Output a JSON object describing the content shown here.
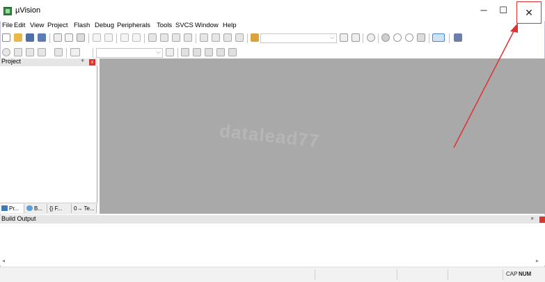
{
  "window": {
    "title": "µVision",
    "minimize": "─",
    "maximize": "☐",
    "close": "✕"
  },
  "menu": [
    "File",
    "Edit",
    "View",
    "Project",
    "Flash",
    "Debug",
    "Peripherals",
    "Tools",
    "SVCS",
    "Window",
    "Help"
  ],
  "project_panel": {
    "title": "Project",
    "pin": "ᵠ",
    "close": "x",
    "tabs": [
      {
        "label": "Pr...",
        "icon": "project-tab-icon"
      },
      {
        "label": "B...",
        "icon": "books-tab-icon"
      },
      {
        "label": "F...",
        "icon": "functions-tab-icon",
        "prefix": "{}"
      },
      {
        "label": "Te...",
        "icon": "templates-tab-icon",
        "prefix": "0→"
      }
    ]
  },
  "editor": {
    "watermark": "datalead77"
  },
  "build_output": {
    "title": "Build Output",
    "pin": "ᵠ"
  },
  "statusbar": {
    "cap": "CAP",
    "num": "NUM"
  },
  "colors": {
    "editor_bg": "#a9a9a9",
    "annotation": "#e03030"
  }
}
